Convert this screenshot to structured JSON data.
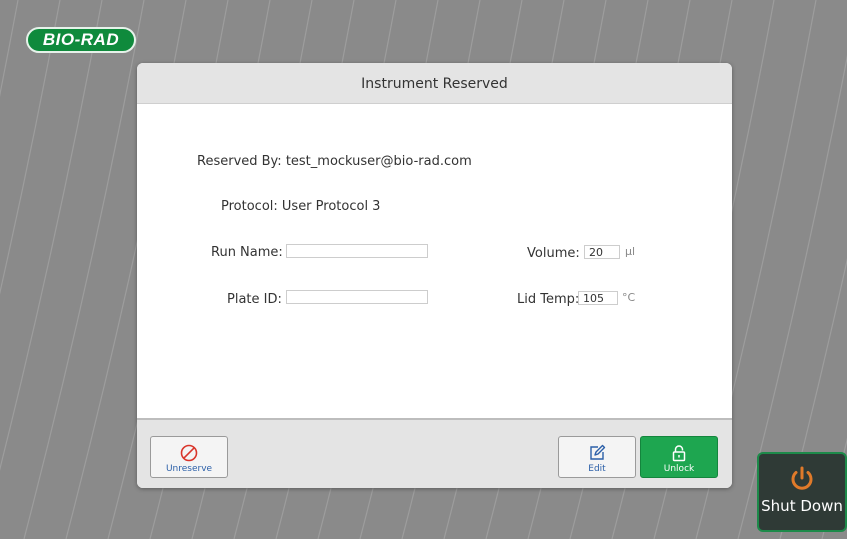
{
  "brand": {
    "logo_text": "BIO-RAD"
  },
  "dialog": {
    "title": "Instrument Reserved",
    "reserved_by": "Reserved By: test_mockuser@bio-rad.com",
    "protocol": "Protocol: User Protocol 3",
    "fields": {
      "run_name": {
        "label": "Run Name:",
        "value": ""
      },
      "plate_id": {
        "label": "Plate ID:",
        "value": ""
      },
      "volume": {
        "label": "Volume:",
        "value": "20",
        "unit": "μl"
      },
      "lid_temp": {
        "label": "Lid Temp:",
        "value": "105",
        "unit": "°C"
      }
    },
    "buttons": {
      "unreserve": {
        "label": "Unreserve",
        "icon": "prohibited-icon"
      },
      "edit": {
        "label": "Edit",
        "icon": "edit-icon"
      },
      "unlock": {
        "label": "Unlock",
        "icon": "unlock-icon"
      }
    }
  },
  "shutdown": {
    "label": "Shut Down",
    "icon": "power-icon"
  },
  "colors": {
    "background": "#8a8a8a",
    "brand_green": "#0f8a3c",
    "unlock_green": "#1ea650",
    "unreserve_red": "#d9352b",
    "link_blue": "#2b5fa8",
    "power_orange": "#e07a2a"
  }
}
